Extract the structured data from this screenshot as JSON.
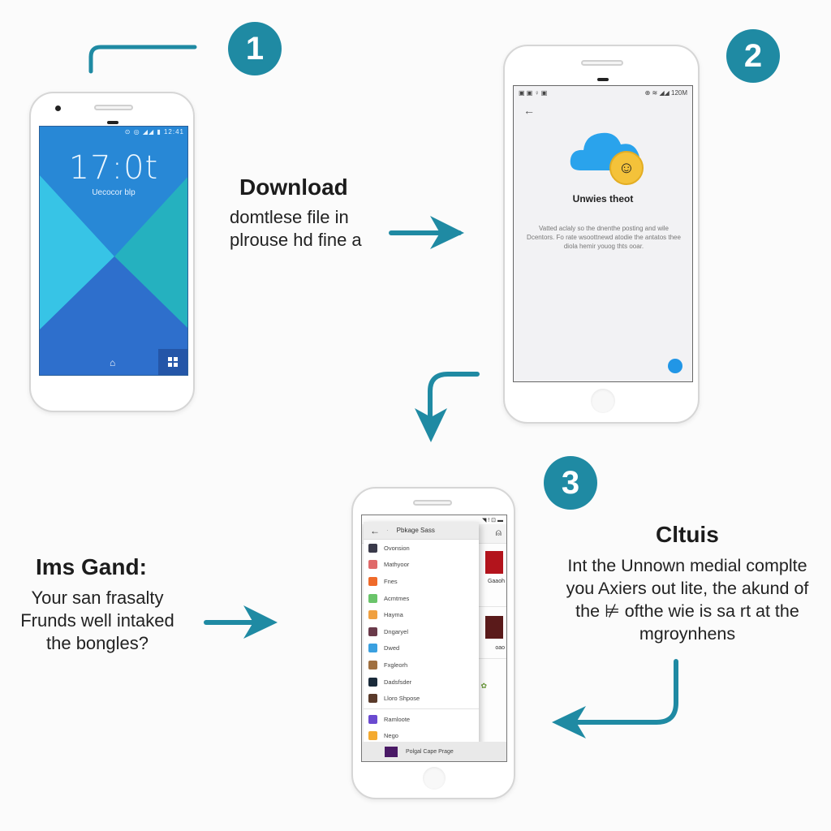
{
  "steps": [
    {
      "number": "1"
    },
    {
      "number": "2"
    },
    {
      "number": "3"
    }
  ],
  "accent_color": "#1f8aa3",
  "phone1": {
    "status_bar": "⊙ ◎ ◢◢ ▮ 12:41",
    "clock": "17:0t",
    "date": "Uecocor blp",
    "nav_home_icon": "home-icon",
    "nav_apps_icon": "grid-icon",
    "wallpaper_colors": [
      "#2f7fd0",
      "#37c4e6",
      "#25b1bf",
      "#2e6fcc"
    ]
  },
  "step1_text": {
    "heading": "Download",
    "lines": [
      "domtlese file in",
      "plrouse hd fine a"
    ]
  },
  "phone2": {
    "status_left": "▣ ▣ ♀ ▣",
    "status_right": "⊕ ≋ ◢◢ 120M",
    "back_icon": "back-arrow-icon",
    "title": "Unwies theot",
    "description": "Vatted aclaly so the dnenthe posting and wile Dcentors. Fo rate wsoottnewd atodie the antatos thee diola hemir youog thts ooar.",
    "fab_icon": "refresh-icon"
  },
  "phone3": {
    "status": "◥ ! ⊡ ▬",
    "drawer_title": "Pbkage Sass",
    "drawer_items": [
      {
        "label": "Ovonsion",
        "color": "#3a3a4a"
      },
      {
        "label": "Mathyoor",
        "color": "#e06a6a"
      },
      {
        "label": "Fnes",
        "color": "#ef6a2a"
      },
      {
        "label": "Acmtmes",
        "color": "#6ac46a"
      },
      {
        "label": "Hayma",
        "color": "#f0a040"
      },
      {
        "label": "Dngaryel",
        "color": "#6a3a4a"
      },
      {
        "label": "Dwed",
        "color": "#3aa0e0"
      },
      {
        "label": "Fxgleorh",
        "color": "#a07040"
      },
      {
        "label": "Dadsfsder",
        "color": "#1a2a3a"
      },
      {
        "label": "Lloro Shpose",
        "color": "#5a3a2a"
      },
      {
        "label": "Ramloote",
        "color": "#6a4ad0"
      },
      {
        "label": "Nego",
        "color": "#f4aa30"
      }
    ],
    "bg_label_1": "Gaaoh",
    "bg_label_2": "oao",
    "bottom_bar": "Polgal Cape Prage",
    "share_icon": "share-icon"
  },
  "step_left_text": {
    "heading": "Ims Gand:",
    "lines": [
      "Your san frasalty",
      "Frunds well intaked",
      "the bongles?"
    ]
  },
  "step3_text": {
    "heading": "Cltuis",
    "lines": [
      "Int the Unnown medial complte",
      "you Axiers out lite, the akund of",
      "the ⊭ ofthe wie is sa rt at the",
      "mgroynhens"
    ]
  }
}
